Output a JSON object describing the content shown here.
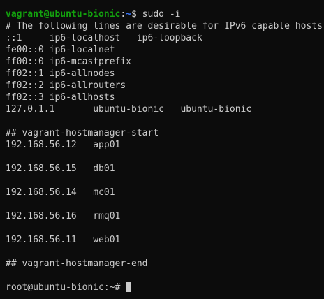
{
  "colors": {
    "background": "#0c0c0c",
    "foreground": "#cccccc",
    "prompt_user": "#13a10e",
    "prompt_path": "#3b78ff"
  },
  "prompt1": {
    "user_host": "vagrant@ubuntu-bionic",
    "sep": ":",
    "path": "~",
    "symbol": "$",
    "command": " sudo -i"
  },
  "output": [
    "# The following lines are desirable for IPv6 capable hosts",
    "::1     ip6-localhost   ip6-loopback",
    "fe00::0 ip6-localnet",
    "ff00::0 ip6-mcastprefix",
    "ff02::1 ip6-allnodes",
    "ff02::2 ip6-allrouters",
    "ff02::3 ip6-allhosts",
    "127.0.1.1       ubuntu-bionic   ubuntu-bionic",
    "",
    "## vagrant-hostmanager-start",
    "192.168.56.12   app01",
    "",
    "192.168.56.15   db01",
    "",
    "192.168.56.14   mc01",
    "",
    "192.168.56.16   rmq01",
    "",
    "192.168.56.11   web01",
    "",
    "## vagrant-hostmanager-end",
    ""
  ],
  "prompt2": {
    "text": "root@ubuntu-bionic:~# "
  }
}
